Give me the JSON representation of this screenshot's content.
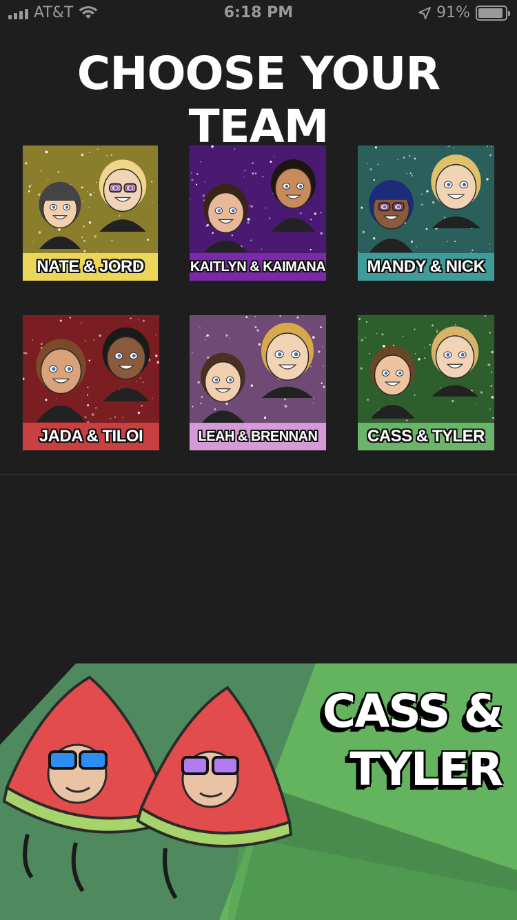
{
  "status_bar": {
    "carrier": "AT&T",
    "time": "6:18 PM",
    "battery_percent": "91%",
    "battery_level": 0.91,
    "icons": [
      "signal-icon",
      "wifi-icon",
      "location-icon",
      "battery-icon"
    ]
  },
  "title": "CHOOSE YOUR TEAM",
  "teams": [
    {
      "label": "NATE & JORD",
      "bg": "#8a7d2c",
      "label_bg": "#ecd65a"
    },
    {
      "label": "KAITLYN & KAIMANA",
      "bg": "#4a1a72",
      "label_bg": "#7a2aa8"
    },
    {
      "label": "MANDY & NICK",
      "bg": "#2b5f5c",
      "label_bg": "#3f9c9a"
    },
    {
      "label": "JADA & TILOI",
      "bg": "#7a1e22",
      "label_bg": "#c94040"
    },
    {
      "label": "LEAH & BRENNAN",
      "bg": "#6e4a74",
      "label_bg": "#d79ad9"
    },
    {
      "label": "CASS & TYLER",
      "bg": "#2f5e2d",
      "label_bg": "#6ab56a"
    }
  ],
  "selected_team": {
    "line1": "CASS &",
    "line2": "TYLER"
  },
  "colors": {
    "background": "#1e1e1e",
    "banner_dark_green": "#4e8a5e",
    "banner_light_green": "#63b35f"
  }
}
